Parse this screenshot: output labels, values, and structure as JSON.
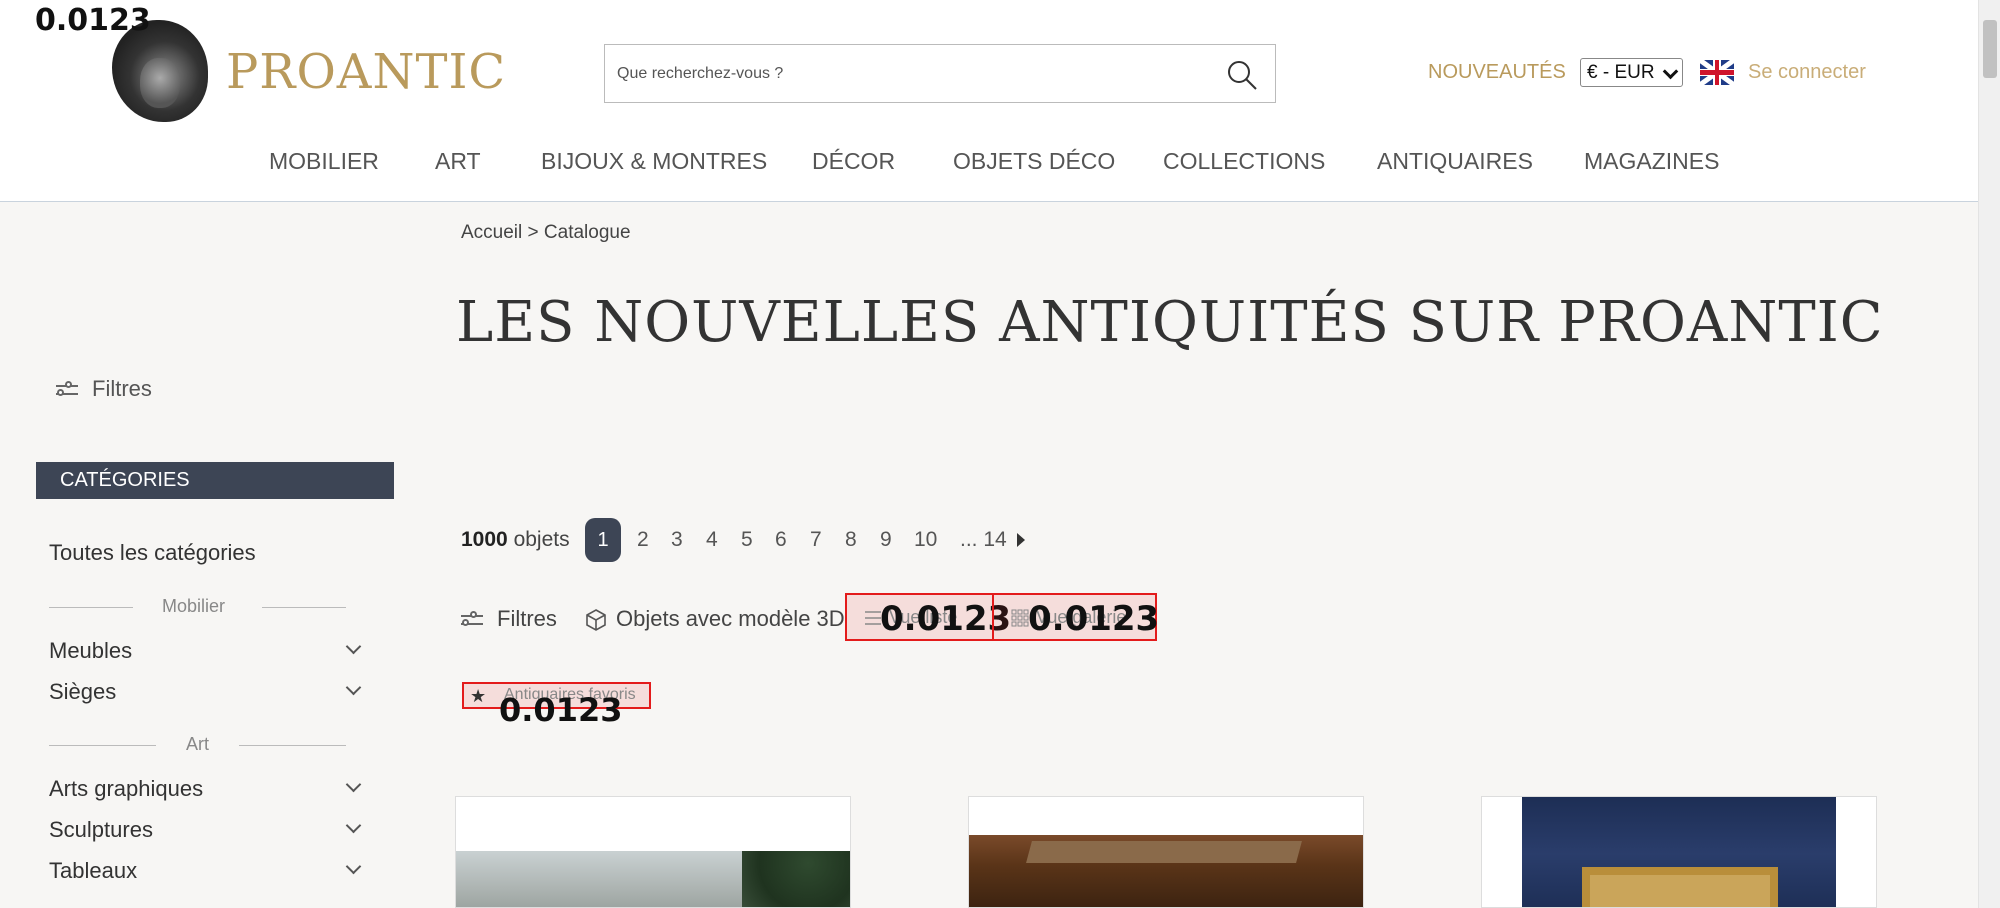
{
  "overlay_numbers": {
    "top_left": "0.0123",
    "view_list": "0.0123",
    "view_grid": "0.0123",
    "favorites": "0.0123"
  },
  "header": {
    "logo_text": "PROANTIC",
    "search_placeholder": "Que recherchez-vous ?",
    "nouveautes": "NOUVEAUTÉS",
    "currency": "€ - EUR",
    "login": "Se connecter",
    "nav": [
      "MOBILIER",
      "ART",
      "BIJOUX & MONTRES",
      "DÉCOR",
      "OBJETS DÉCO",
      "COLLECTIONS",
      "ANTIQUAIRES",
      "MAGAZINES"
    ]
  },
  "sidebar": {
    "filters_label": "Filtres",
    "categories_header": "CATÉGORIES",
    "all_categories": "Toutes les catégories",
    "section_mobilier": "Mobilier",
    "meubles": "Meubles",
    "sieges": "Sièges",
    "section_art": "Art",
    "arts_graphiques": "Arts graphiques",
    "sculptures": "Sculptures",
    "tableaux": "Tableaux"
  },
  "main": {
    "breadcrumb": "Accueil > Catalogue",
    "title": "LES NOUVELLES ANTIQUITÉS SUR PROANTIC",
    "count_number": "1000",
    "count_label": "objets",
    "pages": [
      "1",
      "2",
      "3",
      "4",
      "5",
      "6",
      "7",
      "8",
      "9",
      "10",
      "... 14"
    ],
    "toolbar": {
      "filters": "Filtres",
      "models3d": "Objets avec modèle 3D",
      "view_list": "Vue liste",
      "view_grid": "Vue galerie"
    },
    "favorites": "Antiquaires favoris"
  },
  "colors": {
    "gold": "#b99a5c",
    "dark": "#3d4555",
    "highlight": "#e31b1b"
  }
}
